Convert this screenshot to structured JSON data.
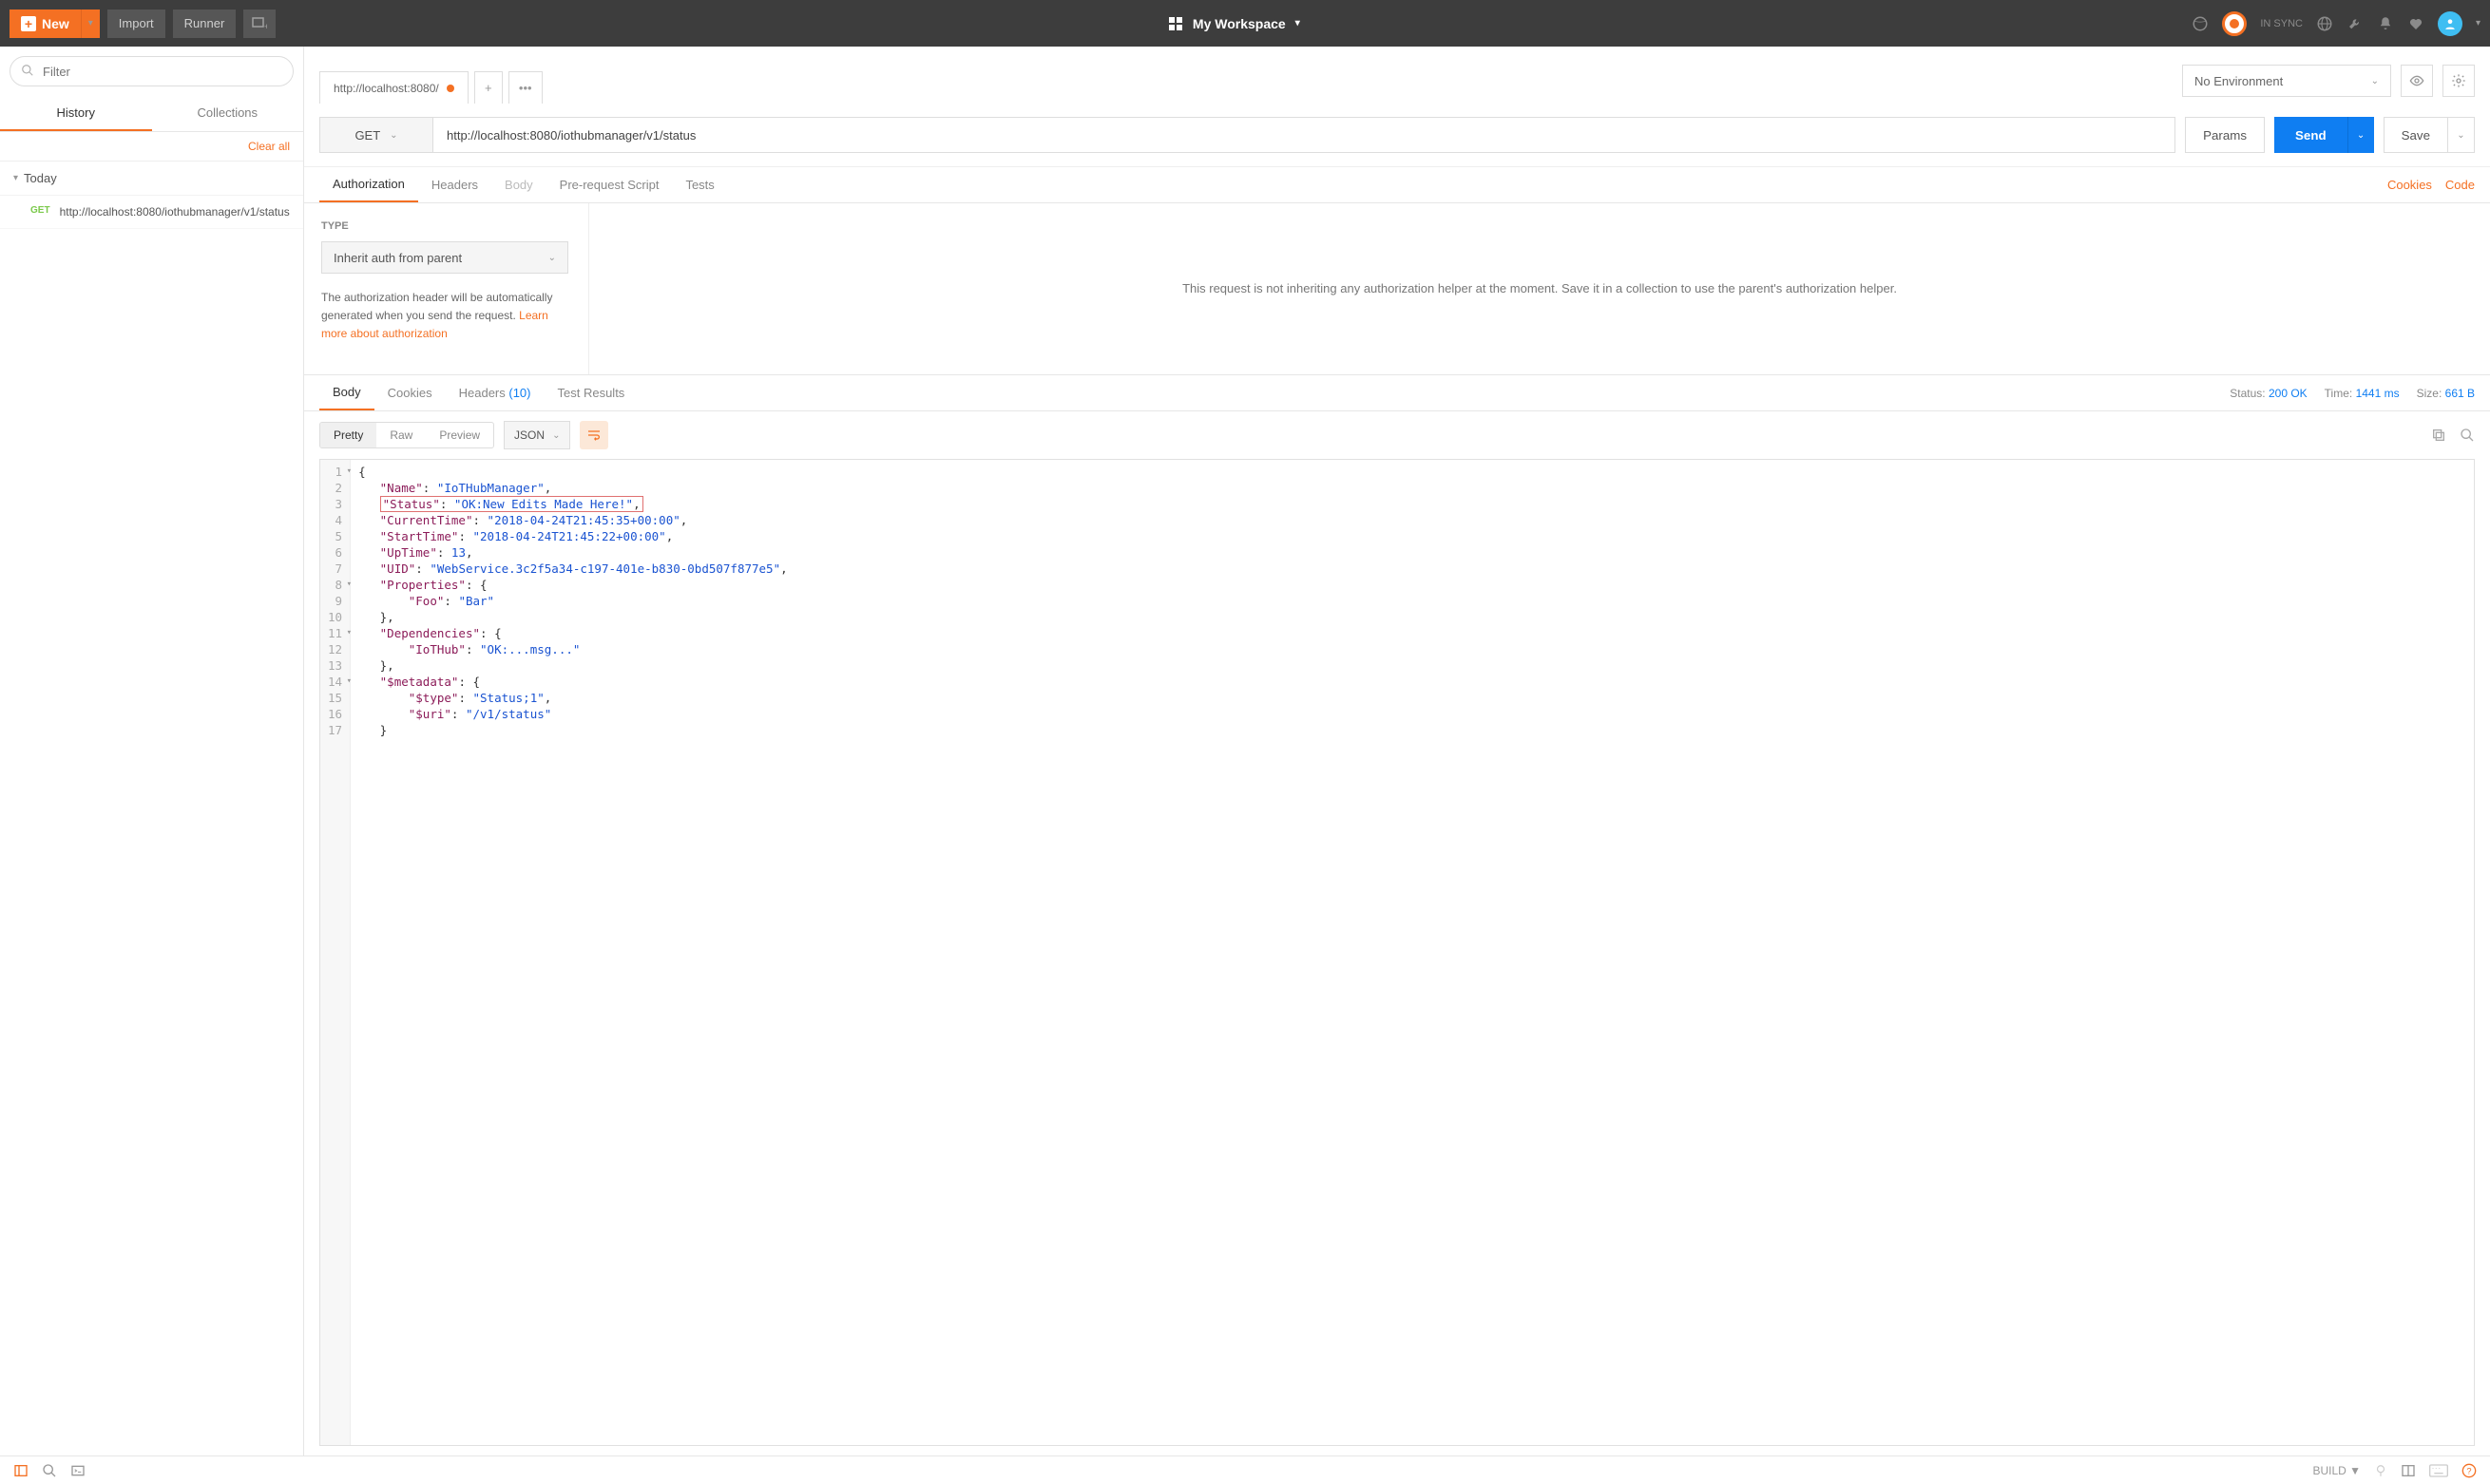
{
  "topbar": {
    "new": "New",
    "import": "Import",
    "runner": "Runner",
    "workspace": "My Workspace",
    "sync": "IN SYNC"
  },
  "sidebar": {
    "filter_placeholder": "Filter",
    "tabs": {
      "history": "History",
      "collections": "Collections"
    },
    "clear_all": "Clear all",
    "group": "Today",
    "history_item": {
      "method": "GET",
      "url": "http://localhost:8080/iothubmanager/v1/status"
    }
  },
  "content": {
    "tab_label": "http://localhost:8080/",
    "env": {
      "label": "No Environment"
    },
    "method": "GET",
    "url": "http://localhost:8080/iothubmanager/v1/status",
    "params": "Params",
    "send": "Send",
    "save": "Save",
    "subtabs": {
      "auth": "Authorization",
      "headers": "Headers",
      "body": "Body",
      "prerequest": "Pre-request Script",
      "tests": "Tests"
    },
    "cookies_link": "Cookies",
    "code_link": "Code"
  },
  "auth": {
    "type_label": "TYPE",
    "selected": "Inherit auth from parent",
    "desc_pre": "The authorization header will be automatically generated when you send the request. ",
    "learn_more": "Learn more about authorization",
    "right_msg": "This request is not inheriting any authorization helper at the moment. Save it in a collection to use the parent's authorization helper."
  },
  "response": {
    "tabs": {
      "body": "Body",
      "cookies": "Cookies",
      "headers": "Headers",
      "headers_count": "(10)",
      "test_results": "Test Results"
    },
    "meta": {
      "status_label": "Status:",
      "status": "200 OK",
      "time_label": "Time:",
      "time": "1441 ms",
      "size_label": "Size:",
      "size": "661 B"
    },
    "pretty": "Pretty",
    "raw": "Raw",
    "preview": "Preview",
    "format": "JSON",
    "json_lines": [
      {
        "n": 1,
        "fold": true,
        "html": "<span class='p'>{</span>"
      },
      {
        "n": 2,
        "html": "   <span class='k'>\"Name\"</span><span class='p'>:</span> <span class='s'>\"IoTHubManager\"</span><span class='p'>,</span>"
      },
      {
        "n": 3,
        "html": "   <span class='hl'><span class='k'>\"Status\"</span><span class='p'>:</span> <span class='s'>\"OK:New Edits Made Here!\"</span><span class='p'>,</span></span>"
      },
      {
        "n": 4,
        "html": "   <span class='k'>\"CurrentTime\"</span><span class='p'>:</span> <span class='s'>\"2018-04-24T21:45:35+00:00\"</span><span class='p'>,</span>"
      },
      {
        "n": 5,
        "html": "   <span class='k'>\"StartTime\"</span><span class='p'>:</span> <span class='s'>\"2018-04-24T21:45:22+00:00\"</span><span class='p'>,</span>"
      },
      {
        "n": 6,
        "html": "   <span class='k'>\"UpTime\"</span><span class='p'>:</span> <span class='n'>13</span><span class='p'>,</span>"
      },
      {
        "n": 7,
        "html": "   <span class='k'>\"UID\"</span><span class='p'>:</span> <span class='s'>\"WebService.3c2f5a34-c197-401e-b830-0bd507f877e5\"</span><span class='p'>,</span>"
      },
      {
        "n": 8,
        "fold": true,
        "html": "   <span class='k'>\"Properties\"</span><span class='p'>:</span> <span class='p'>{</span>"
      },
      {
        "n": 9,
        "html": "       <span class='k'>\"Foo\"</span><span class='p'>:</span> <span class='s'>\"Bar\"</span>"
      },
      {
        "n": 10,
        "html": "   <span class='p'>},</span>"
      },
      {
        "n": 11,
        "fold": true,
        "html": "   <span class='k'>\"Dependencies\"</span><span class='p'>:</span> <span class='p'>{</span>"
      },
      {
        "n": 12,
        "html": "       <span class='k'>\"IoTHub\"</span><span class='p'>:</span> <span class='s'>\"OK:...msg...\"</span>"
      },
      {
        "n": 13,
        "html": "   <span class='p'>},</span>"
      },
      {
        "n": 14,
        "fold": true,
        "html": "   <span class='k'>\"$metadata\"</span><span class='p'>:</span> <span class='p'>{</span>"
      },
      {
        "n": 15,
        "html": "       <span class='k'>\"$type\"</span><span class='p'>:</span> <span class='s'>\"Status;1\"</span><span class='p'>,</span>"
      },
      {
        "n": 16,
        "html": "       <span class='k'>\"$uri\"</span><span class='p'>:</span> <span class='s'>\"/v1/status\"</span>"
      },
      {
        "n": 17,
        "html": "   <span class='p'>}</span>"
      }
    ]
  },
  "statusbar": {
    "build": "BUILD ▼"
  }
}
